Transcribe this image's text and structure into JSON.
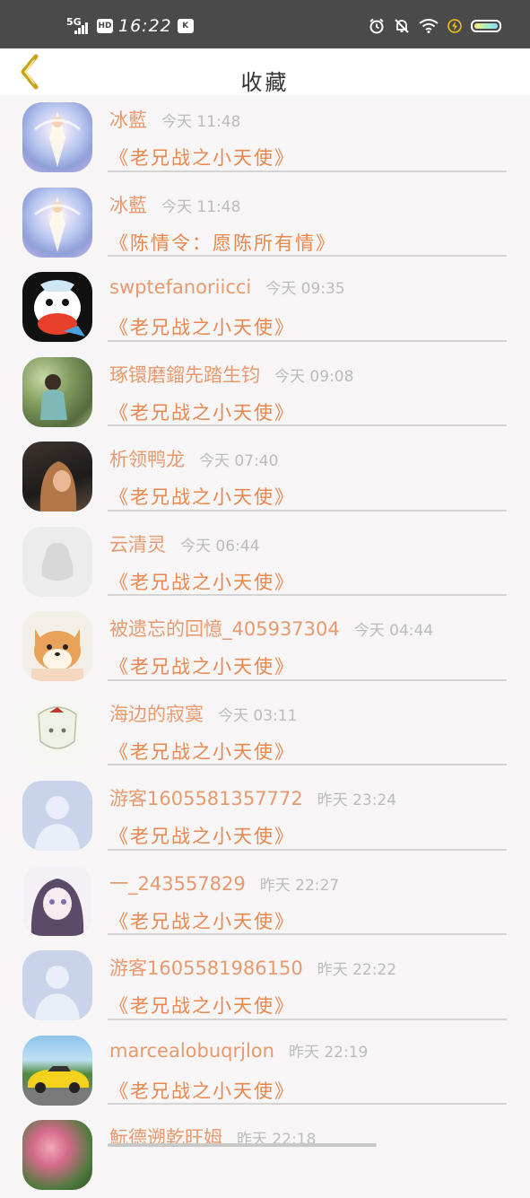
{
  "status_bar": {
    "network": "5G",
    "hd": "HD",
    "time": "16:22",
    "app_badge": "K",
    "icons": [
      "alarm-icon",
      "mute-icon",
      "wifi-icon",
      "charging-icon",
      "battery-icon"
    ]
  },
  "header": {
    "title": "收藏",
    "back_icon": "chevron-left-icon"
  },
  "colors": {
    "name": "#e89a6f",
    "time": "#bcbcbc",
    "book": "#e8884f",
    "back": "#c9a21a"
  },
  "items": [
    {
      "name": "冰藍",
      "time": "今天 11:48",
      "book": "《老兄战之小天使》",
      "avatar": "fairy-avatar"
    },
    {
      "name": "冰藍",
      "time": "今天 11:48",
      "book": "《陈情令：愿陈所有情》",
      "avatar": "fairy-avatar"
    },
    {
      "name": "swptefanoriicci",
      "time": "今天 09:35",
      "book": "《老兄战之小天使》",
      "avatar": "monkey-avatar"
    },
    {
      "name": "琢镮磨鎦先踏生钧",
      "time": "今天 09:08",
      "book": "《老兄战之小天使》",
      "avatar": "girl-photo-avatar"
    },
    {
      "name": "析领鸭龙",
      "time": "今天 07:40",
      "book": "《老兄战之小天使》",
      "avatar": "portrait-avatar"
    },
    {
      "name": "云清灵",
      "time": "今天 06:44",
      "book": "《老兄战之小天使》",
      "avatar": "default-penguin-avatar"
    },
    {
      "name": "被遗忘的回憶_405937304",
      "time": "今天 04:44",
      "book": "《老兄战之小天使》",
      "avatar": "shiba-avatar"
    },
    {
      "name": "海边的寂寞",
      "time": "今天 03:11",
      "book": "《老兄战之小天使》",
      "avatar": "anime-sketch-avatar"
    },
    {
      "name": "游客1605581357772",
      "time": "昨天 23:24",
      "book": "《老兄战之小天使》",
      "avatar": "default-person-avatar"
    },
    {
      "name": "一_243557829",
      "time": "昨天 22:27",
      "book": "《老兄战之小天使》",
      "avatar": "anime-girl-avatar"
    },
    {
      "name": "游客1605581986150",
      "time": "昨天 22:22",
      "book": "《老兄战之小天使》",
      "avatar": "default-person-avatar"
    },
    {
      "name": "marcealobuqrjlon",
      "time": "昨天 22:19",
      "book": "《老兄战之小天使》",
      "avatar": "car-avatar"
    },
    {
      "name": "魭德遡乾旺姆",
      "time": "昨天 22:18",
      "book": "",
      "avatar": "flower-avatar"
    }
  ]
}
